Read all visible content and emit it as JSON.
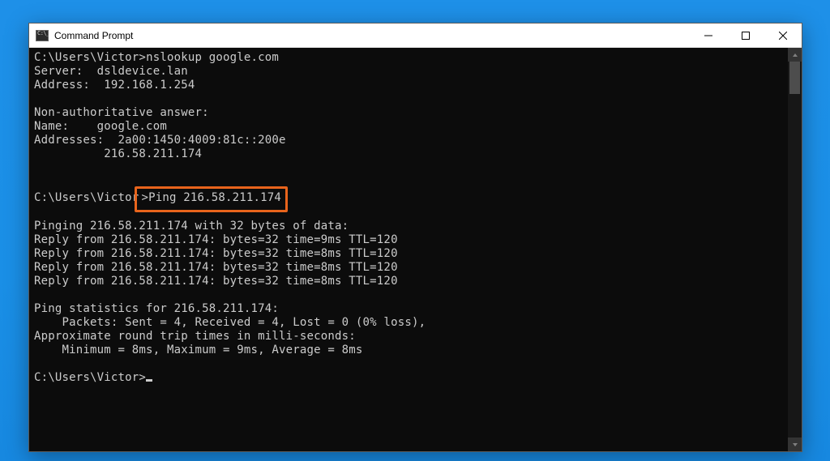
{
  "window": {
    "title": "Command Prompt"
  },
  "terminal": {
    "l1a": "C:\\Users\\Victor>",
    "l1b": "nslookup google.com",
    "l2": "Server:  dsldevice.lan",
    "l3": "Address:  192.168.1.254",
    "l4": "",
    "l5": "Non-authoritative answer:",
    "l6": "Name:    google.com",
    "l7": "Addresses:  2a00:1450:4009:81c::200e",
    "l8": "          216.58.211.174",
    "l9": "",
    "l10": "",
    "l11a": "C:\\Users\\Victor",
    "l11b": ">Ping 216.58.211.174",
    "l12": "",
    "l13": "Pinging 216.58.211.174 with 32 bytes of data:",
    "l14": "Reply from 216.58.211.174: bytes=32 time=9ms TTL=120",
    "l15": "Reply from 216.58.211.174: bytes=32 time=8ms TTL=120",
    "l16": "Reply from 216.58.211.174: bytes=32 time=8ms TTL=120",
    "l17": "Reply from 216.58.211.174: bytes=32 time=8ms TTL=120",
    "l18": "",
    "l19": "Ping statistics for 216.58.211.174:",
    "l20": "    Packets: Sent = 4, Received = 4, Lost = 0 (0% loss),",
    "l21": "Approximate round trip times in milli-seconds:",
    "l22": "    Minimum = 8ms, Maximum = 9ms, Average = 8ms",
    "l23": "",
    "l24": "C:\\Users\\Victor>"
  }
}
